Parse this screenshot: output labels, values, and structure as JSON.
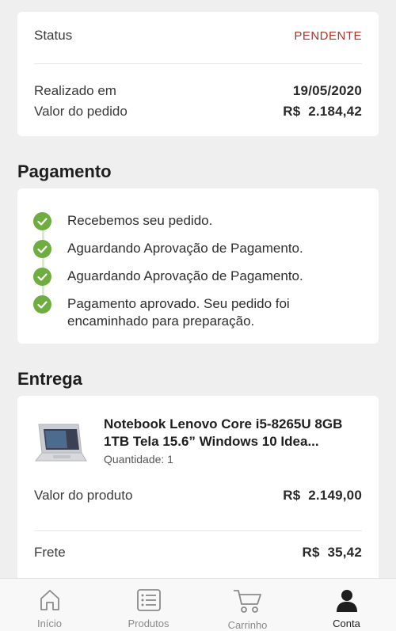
{
  "summary": {
    "status_label": "Status",
    "status_value": "PENDENTE",
    "date_label": "Realizado em",
    "date_value": "19/05/2020",
    "total_label": "Valor do pedido",
    "total_value": "R$  2.184,42"
  },
  "payment": {
    "title": "Pagamento",
    "steps": [
      {
        "text": "Recebemos seu pedido."
      },
      {
        "text": "Aguardando Aprovação de Pagamento."
      },
      {
        "text": "Aguardando Aprovação de Pagamento."
      },
      {
        "text": "Pagamento aprovado. Seu pedido foi encaminhado para preparação."
      }
    ]
  },
  "delivery": {
    "title": "Entrega",
    "product_name": "Notebook Lenovo Core i5-8265U 8GB 1TB Tela 15.6” Windows 10 Idea...",
    "quantity": "Quantidade: 1",
    "product_value_label": "Valor do produto",
    "product_value": "R$  2.149,00",
    "shipping_label": "Frete",
    "shipping_value": "R$  35,42"
  },
  "tabbar": {
    "items": [
      {
        "label": "Início",
        "icon": "home-icon"
      },
      {
        "label": "Produtos",
        "icon": "list-icon"
      },
      {
        "label": "Carrinho",
        "icon": "cart-icon"
      },
      {
        "label": "Conta",
        "icon": "user-icon",
        "active": true
      }
    ]
  },
  "colors": {
    "status": "#b3302a",
    "check": "#6dae3f",
    "background": "#efefef"
  }
}
